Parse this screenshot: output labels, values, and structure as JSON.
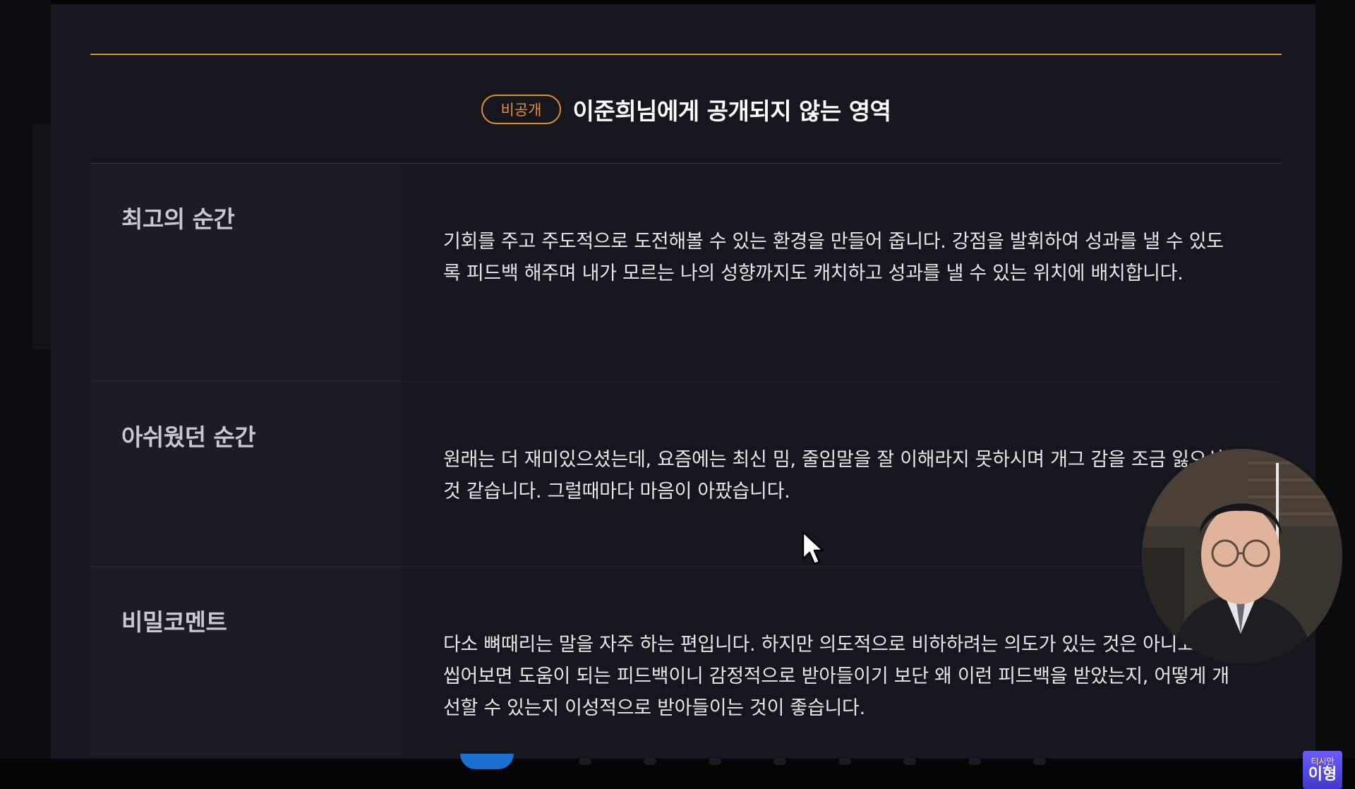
{
  "header": {
    "badge": "비공개",
    "title": "이준희님에게 공개되지 않는 영역"
  },
  "rows": [
    {
      "label": "최고의 순간",
      "text": "기회를 주고 주도적으로 도전해볼 수 있는 환경을 만들어 줍니다. 강점을 발휘하여 성과를 낼 수 있도록 피드백 해주며 내가 모르는 나의 성향까지도 캐치하고 성과를 낼 수 있는 위치에 배치합니다."
    },
    {
      "label": "아쉬웠던 순간",
      "text": "원래는 더 재미있으셨는데, 요즘에는 최신 밈, 줄임말을 잘 이해라지 못하시며 개그 감을 조금 잃으신것 같습니다. 그럴때마다 마음이 아팠습니다."
    },
    {
      "label": "비밀코멘트",
      "text": "다소 뼈때리는 말을 자주 하는 편입니다. 하지만 의도적으로 비하하려는 의도가 있는 것은 아니고 곱씹어보면 도움이 되는 피드백이니 감정적으로 받아들이기 보단 왜 이런 피드백을 받았는지, 어떻게 개선할 수 있는지 이성적으로 받아들이는 것이 좋습니다."
    }
  ],
  "watermark": {
    "small": "티시안",
    "big": "이형"
  },
  "colors": {
    "accent": "#e2902a",
    "panel": "#16161e",
    "label_bg": "#1c1c26",
    "pager_blue": "#1a6fd0"
  },
  "icons": {
    "cursor": "arrow-cursor-icon"
  }
}
